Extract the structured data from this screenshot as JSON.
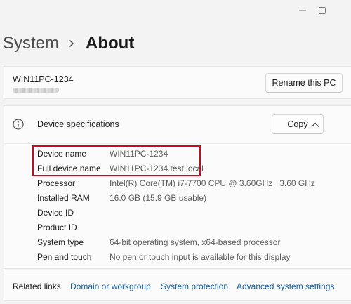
{
  "window": {
    "controls": [
      "minimize-icon",
      "maximize-icon"
    ]
  },
  "breadcrumb": {
    "parent": "System",
    "current": "About"
  },
  "pc_card": {
    "device_name": "WIN11PC-1234",
    "rename_label": "Rename this PC"
  },
  "specs": {
    "title": "Device specifications",
    "copy_label": "Copy",
    "rows": [
      {
        "label": "Device name",
        "value": "WIN11PC-1234"
      },
      {
        "label": "Full device name",
        "value": "WIN11PC-1234.test.local"
      },
      {
        "label": "Processor",
        "value": "Intel(R) Core(TM) i7-7700 CPU @ 3.60GHz   3.60 GHz"
      },
      {
        "label": "Installed RAM",
        "value": "16.0 GB (15.9 GB usable)"
      },
      {
        "label": "Device ID",
        "value": ""
      },
      {
        "label": "Product ID",
        "value": ""
      },
      {
        "label": "System type",
        "value": "64-bit operating system, x64-based processor"
      },
      {
        "label": "Pen and touch",
        "value": "No pen or touch input is available for this display"
      }
    ]
  },
  "related_links": {
    "label": "Related links",
    "links": [
      "Domain or workgroup",
      "System protection",
      "Advanced system settings"
    ]
  },
  "colors": {
    "highlight": "#d9001b",
    "link": "#0f5dab"
  }
}
